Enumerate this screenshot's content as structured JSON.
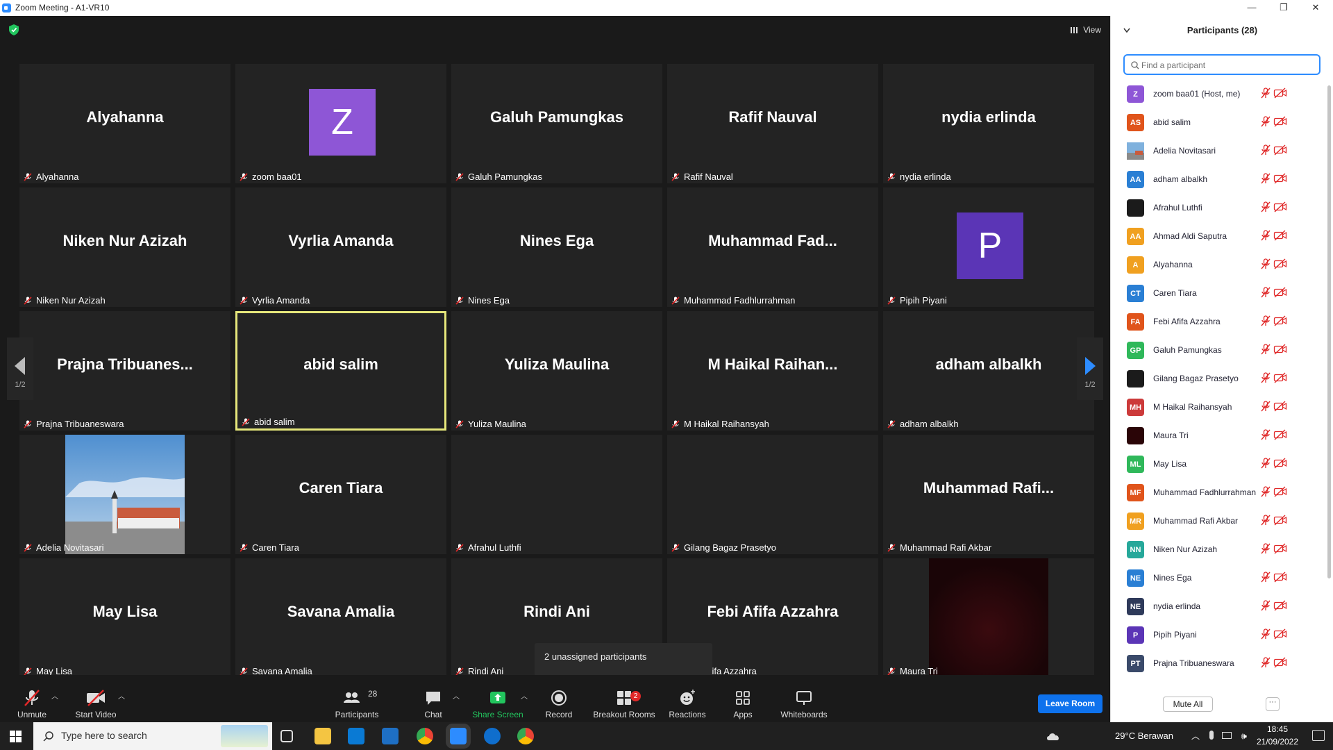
{
  "window": {
    "title": "Zoom Meeting - A1-VR10"
  },
  "view_button": {
    "label": "View"
  },
  "tiles": [
    {
      "display": "Alyahanna",
      "name": "Alyahanna"
    },
    {
      "display": "Z",
      "name": "zoom baa01",
      "avatar_color": "#8e56d6"
    },
    {
      "display": "Galuh Pamungkas",
      "name": "Galuh Pamungkas"
    },
    {
      "display": "Rafif Nauval",
      "name": "Rafif Nauval"
    },
    {
      "display": "nydia erlinda",
      "name": "nydia erlinda"
    },
    {
      "display": "Niken Nur Azizah",
      "name": "Niken Nur Azizah"
    },
    {
      "display": "Vyrlia Amanda",
      "name": "Vyrlia Amanda"
    },
    {
      "display": "Nines Ega",
      "name": "Nines Ega"
    },
    {
      "display": "Muhammad  Fad...",
      "name": "Muhammad Fadhlurrahman"
    },
    {
      "display": "P",
      "name": "Pipih Piyani",
      "avatar_color": "#5b35b6"
    },
    {
      "display": "Prajna  Tribuanes...",
      "name": "Prajna Tribuaneswara"
    },
    {
      "display": "abid salim",
      "name": "abid salim"
    },
    {
      "display": "Yuliza Maulina",
      "name": "Yuliza Maulina"
    },
    {
      "display": "M  Haikal  Raihan...",
      "name": "M Haikal Raihansyah"
    },
    {
      "display": "adham albalkh",
      "name": "adham albalkh"
    },
    {
      "display": "",
      "name": "Adelia Novitasari"
    },
    {
      "display": "Caren Tiara",
      "name": "Caren Tiara"
    },
    {
      "display": "",
      "name": "Afrahul Luthfi"
    },
    {
      "display": "",
      "name": "Gilang Bagaz Prasetyo"
    },
    {
      "display": "Muhammad  Rafi...",
      "name": "Muhammad Rafi Akbar"
    },
    {
      "display": "May Lisa",
      "name": "May Lisa"
    },
    {
      "display": "Savana Amalia",
      "name": "Savana Amalia"
    },
    {
      "display": "Rindi Ani",
      "name": "Rindi Ani"
    },
    {
      "display": "Febi Afifa Azzahra",
      "name": "Febi Afifa Azzahra"
    },
    {
      "display": "",
      "name": "Maura Tri"
    }
  ],
  "page_indicator": {
    "left": "1/2",
    "right": "1/2"
  },
  "unassigned": "2 unassigned participants",
  "toolbar": {
    "unmute": "Unmute",
    "start_video": "Start Video",
    "participants": "Participants",
    "participants_count": "28",
    "chat": "Chat",
    "share_screen": "Share Screen",
    "record": "Record",
    "breakout_rooms": "Breakout Rooms",
    "breakout_badge": "2",
    "reactions": "Reactions",
    "apps": "Apps",
    "whiteboards": "Whiteboards",
    "leave_room": "Leave Room"
  },
  "panel": {
    "title": "Participants (28)",
    "search_placeholder": "Find a participant",
    "mute_all": "Mute All",
    "more": "···",
    "participants": [
      {
        "initials": "Z",
        "name": "zoom baa01 (Host, me)",
        "color": "#8e56d6"
      },
      {
        "initials": "AS",
        "name": "abid salim",
        "color": "#e0541b"
      },
      {
        "initials": "",
        "name": "Adelia Novitasari",
        "color": "#6a9fcf"
      },
      {
        "initials": "AA",
        "name": "adham albalkh",
        "color": "#2a7fd4"
      },
      {
        "initials": "",
        "name": "Afrahul Luthfi",
        "color": "#1b1b1b"
      },
      {
        "initials": "AA",
        "name": "Ahmad Aldi Saputra",
        "color": "#f0a020"
      },
      {
        "initials": "A",
        "name": "Alyahanna",
        "color": "#f0a020"
      },
      {
        "initials": "CT",
        "name": "Caren Tiara",
        "color": "#2a7fd4"
      },
      {
        "initials": "FA",
        "name": "Febi Afifa Azzahra",
        "color": "#e0541b"
      },
      {
        "initials": "GP",
        "name": "Galuh Pamungkas",
        "color": "#2fb85a"
      },
      {
        "initials": "",
        "name": "Gilang Bagaz Prasetyo",
        "color": "#1b1b1b"
      },
      {
        "initials": "MH",
        "name": "M Haikal Raihansyah",
        "color": "#cc3a3a"
      },
      {
        "initials": "",
        "name": "Maura Tri",
        "color": "#2a0507"
      },
      {
        "initials": "ML",
        "name": "May Lisa",
        "color": "#2fb85a"
      },
      {
        "initials": "MF",
        "name": "Muhammad Fadhlurrahman",
        "color": "#e0541b"
      },
      {
        "initials": "MR",
        "name": "Muhammad Rafi Akbar",
        "color": "#f0a020"
      },
      {
        "initials": "NN",
        "name": "Niken Nur Azizah",
        "color": "#26a89a"
      },
      {
        "initials": "NE",
        "name": "Nines Ega",
        "color": "#2a7fd4"
      },
      {
        "initials": "NE",
        "name": "nydia erlinda",
        "color": "#2e3a5a"
      },
      {
        "initials": "P",
        "name": "Pipih Piyani",
        "color": "#5b35b6"
      },
      {
        "initials": "PT",
        "name": "Prajna Tribuaneswara",
        "color": "#3a4a6a"
      }
    ]
  },
  "taskbar": {
    "search_placeholder": "Type here to search",
    "weather": "29°C  Berawan",
    "time": "18:45",
    "date": "21/09/2022"
  },
  "colors": {
    "accent": "#2d8cff",
    "leave": "#0e72ed",
    "muted_red": "#e02828",
    "share_green": "#22c55e",
    "speaker_border": "#e6e77b"
  }
}
